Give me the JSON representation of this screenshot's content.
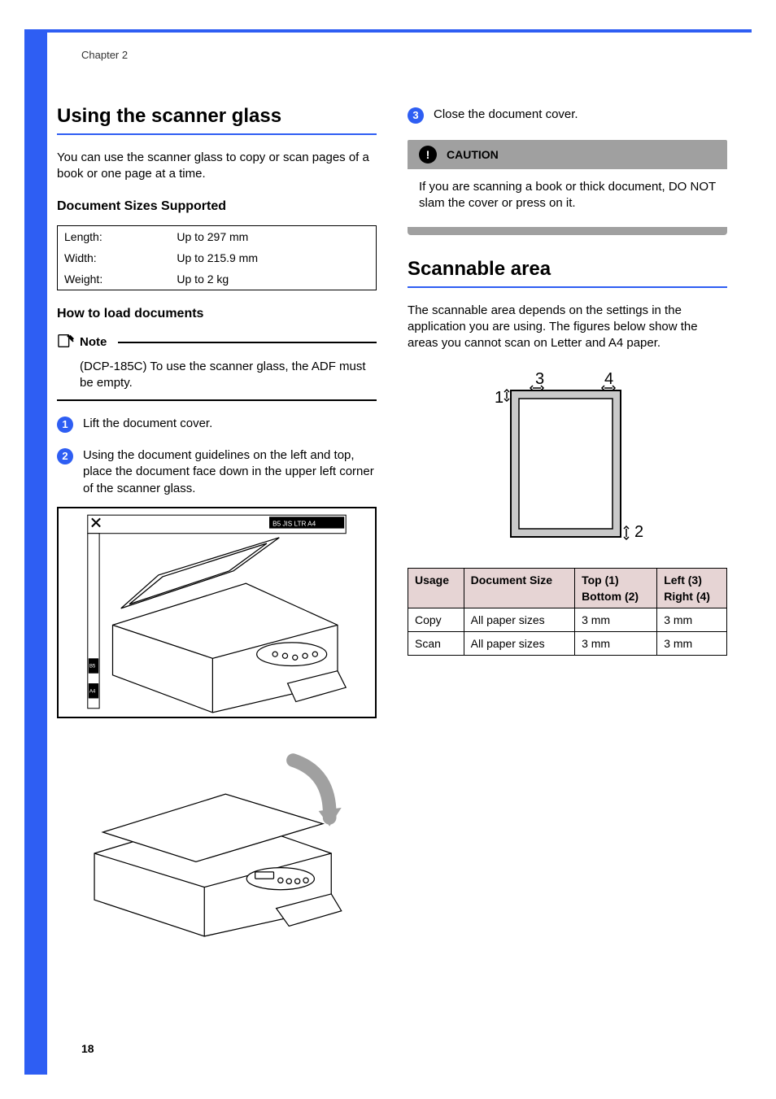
{
  "chapter": "Chapter 2",
  "page_number": "18",
  "left": {
    "heading": "Using the scanner glass",
    "intro": "You can use the scanner glass to copy or scan pages of a book or one page at a time.",
    "sizes_heading": "Document Sizes Supported",
    "sizes_table": {
      "rows": [
        {
          "label": "Length:",
          "value": "Up to 297 mm"
        },
        {
          "label": "Width:",
          "value": "Up to 215.9 mm"
        },
        {
          "label": "Weight:",
          "value": "Up to 2 kg"
        }
      ]
    },
    "howto_heading": "How to load documents",
    "note_label": "Note",
    "note_text": "(DCP-185C) To use the scanner glass, the ADF must be empty.",
    "steps": {
      "s1": {
        "n": "1",
        "text": "Lift the document cover."
      },
      "s2": {
        "n": "2",
        "text": "Using the document guidelines on the left and top, place the document face down in the upper left corner of the scanner glass."
      }
    }
  },
  "right": {
    "step3": {
      "n": "3",
      "text": "Close the document cover."
    },
    "caution_label": "CAUTION",
    "caution_text": "If you are scanning a book or thick document, DO NOT slam the cover or press on it.",
    "heading": "Scannable area",
    "intro": "The scannable area depends on the settings in the application you are using. The figures below show the areas you cannot scan on Letter and A4 paper.",
    "diagram_labels": {
      "l1": "1",
      "l2": "2",
      "l3": "3",
      "l4": "4"
    },
    "table": {
      "headers": {
        "usage": "Usage",
        "docsize": "Document Size",
        "top": "Top (1)",
        "bottom": "Bottom (2)",
        "left": "Left (3)",
        "right": "Right (4)"
      },
      "rows": [
        {
          "usage": "Copy",
          "docsize": "All paper sizes",
          "tb": "3 mm",
          "lr": "3 mm"
        },
        {
          "usage": "Scan",
          "docsize": "All paper sizes",
          "tb": "3 mm",
          "lr": "3 mm"
        }
      ]
    }
  }
}
